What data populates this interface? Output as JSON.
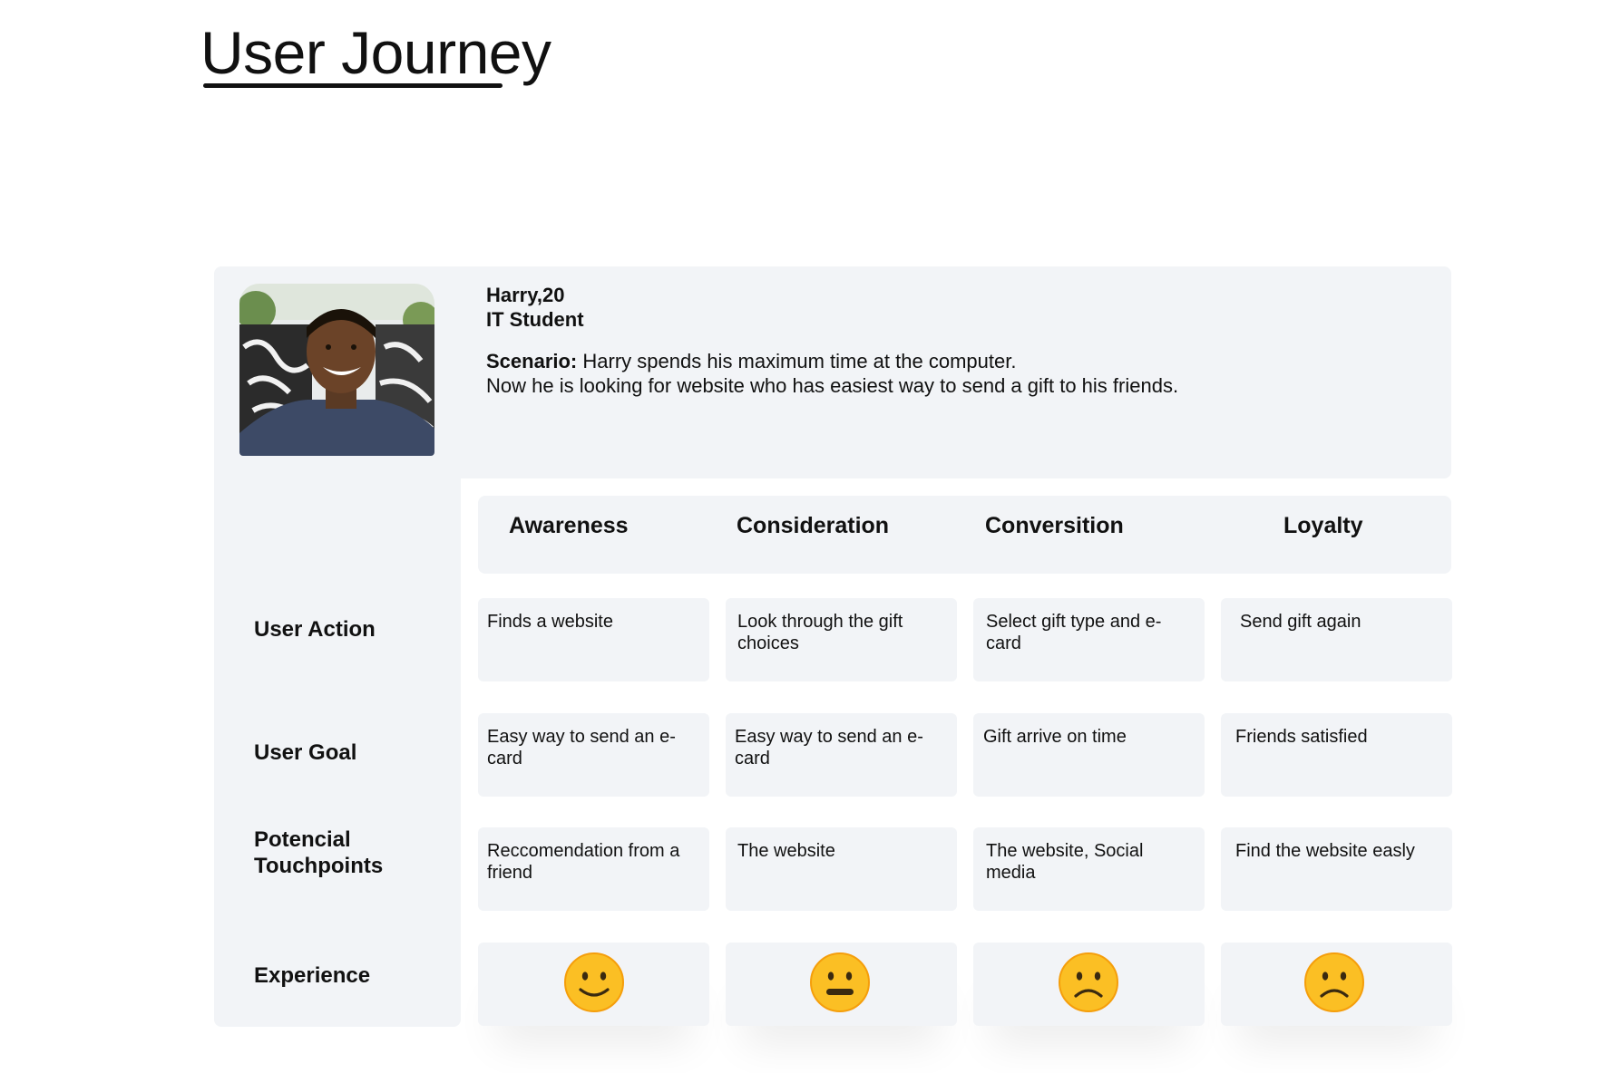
{
  "title": "User Journey",
  "persona": {
    "name": "Harry,20",
    "role": "IT Student",
    "scenario_label": "Scenario:",
    "scenario_line1": " Harry spends his maximum time at the computer.",
    "scenario_line2": "Now he is looking for website who has easiest way to send a gift to his friends."
  },
  "stages": [
    "Awareness",
    "Consideration",
    "Conversition",
    "Loyalty"
  ],
  "rows": {
    "user_action": {
      "label": "User Action",
      "cells": [
        "Finds a website",
        "Look through the gift choices",
        "Select gift type and e-card",
        "Send gift again"
      ]
    },
    "user_goal": {
      "label": "User Goal",
      "cells": [
        "Easy way to send an e-card",
        "Easy way to send an e-card",
        "Gift arrive on time",
        "Friends satisfied"
      ]
    },
    "touchpoints": {
      "label_line1": "Potencial",
      "label_line2": "Touchpoints",
      "cells": [
        "Reccomendation from a friend",
        "The website",
        "The website, Social media",
        "Find the website easly"
      ]
    },
    "experience": {
      "label": "Experience",
      "cells": [
        "happy-face-icon",
        "neutral-face-icon",
        "sad-face-icon",
        "sad-face-icon"
      ]
    }
  },
  "colors": {
    "panel": "#f2f4f7",
    "emoji_fill": "#fbbf24",
    "emoji_edge": "#f59e0b",
    "emoji_feature": "#3a2a10"
  }
}
